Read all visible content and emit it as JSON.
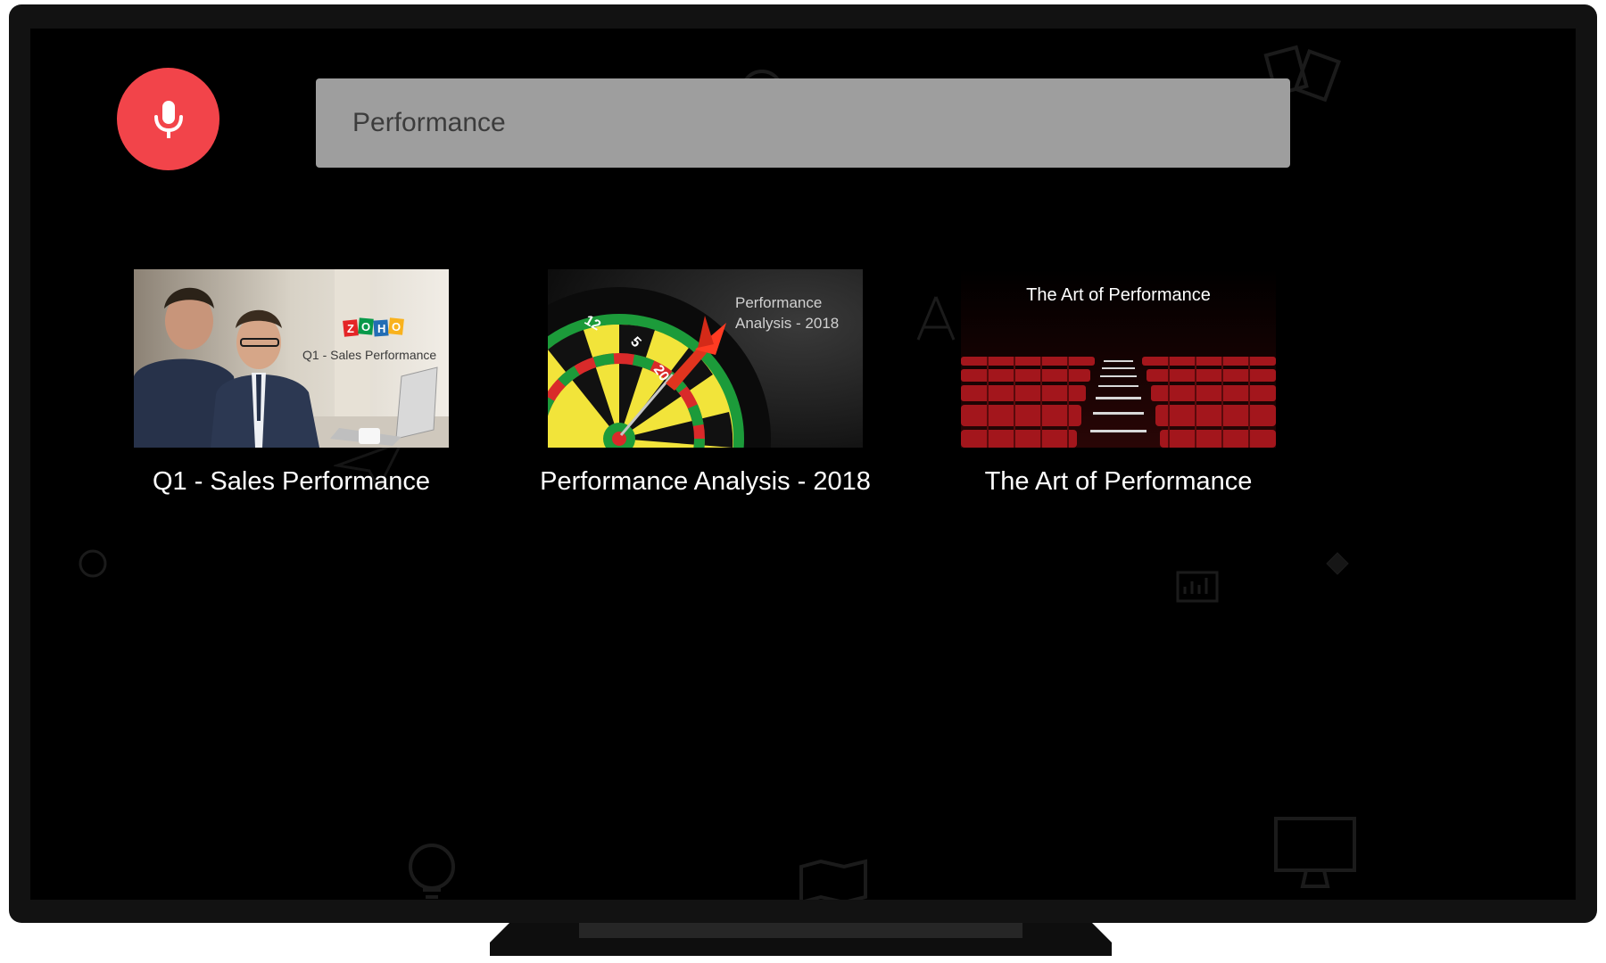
{
  "search": {
    "value": "Performance",
    "mic_icon": "microphone-icon"
  },
  "results": [
    {
      "title": "Q1 - Sales Performance",
      "thumbnail_logo": "ZOHO",
      "thumbnail_caption": "Q1 - Sales Performance"
    },
    {
      "title": "Performance Analysis - 2018",
      "thumbnail_caption_line1": "Performance",
      "thumbnail_caption_line2": "Analysis - 2018"
    },
    {
      "title": "The Art of Performance",
      "thumbnail_caption": "The Art of Performance"
    }
  ],
  "colors": {
    "mic_button": "#f2444a",
    "search_box": "#9e9e9e",
    "screen_background": "#000000",
    "tv_bezel": "#121212",
    "zoho_red": "#e42527",
    "zoho_green": "#089949",
    "zoho_blue": "#226db4",
    "zoho_yellow": "#f9b21d"
  }
}
